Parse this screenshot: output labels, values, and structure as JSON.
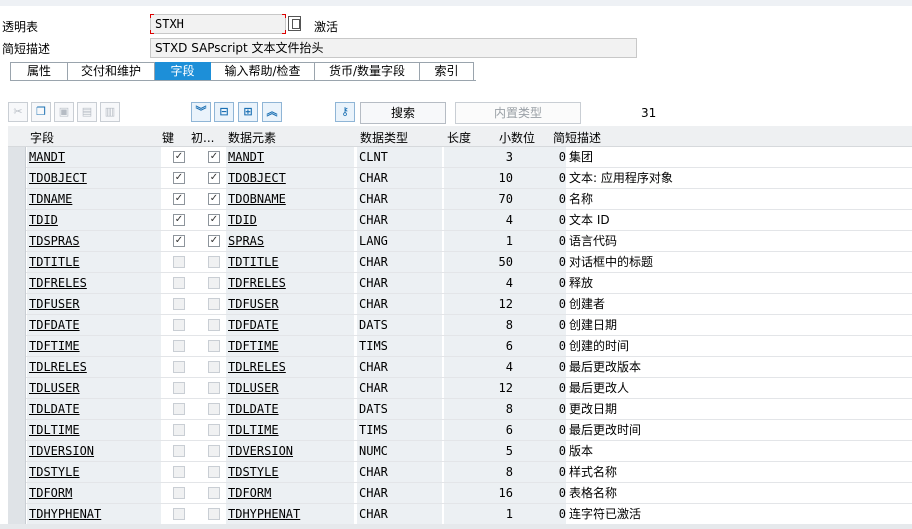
{
  "header": {
    "table_label": "透明表",
    "table_value": "STXH",
    "status": "激活",
    "desc_label": "简短描述",
    "desc_value": "STXD SAPscript 文本文件抬头"
  },
  "tabs": [
    {
      "label": "属性"
    },
    {
      "label": "交付和维护"
    },
    {
      "label": "字段"
    },
    {
      "label": "输入帮助/检查"
    },
    {
      "label": "货币/数量字段"
    },
    {
      "label": "索引"
    }
  ],
  "toolbar": {
    "search_label": "搜索",
    "builtin_label": "内置类型",
    "count": "31"
  },
  "grid": {
    "columns": [
      "字段",
      "键",
      "初...",
      "数据元素",
      "数据类型",
      "长度",
      "小数位",
      "简短描述"
    ],
    "rows": [
      {
        "field": "MANDT",
        "key": true,
        "init": true,
        "elem": "MANDT",
        "type": "CLNT",
        "len": "3",
        "dec": "0",
        "desc": "集团"
      },
      {
        "field": "TDOBJECT",
        "key": true,
        "init": true,
        "elem": "TDOBJECT",
        "type": "CHAR",
        "len": "10",
        "dec": "0",
        "desc": "文本: 应用程序对象"
      },
      {
        "field": "TDNAME",
        "key": true,
        "init": true,
        "elem": "TDOBNAME",
        "type": "CHAR",
        "len": "70",
        "dec": "0",
        "desc": "名称"
      },
      {
        "field": "TDID",
        "key": true,
        "init": true,
        "elem": "TDID",
        "type": "CHAR",
        "len": "4",
        "dec": "0",
        "desc": "文本 ID"
      },
      {
        "field": "TDSPRAS",
        "key": true,
        "init": true,
        "elem": "SPRAS",
        "type": "LANG",
        "len": "1",
        "dec": "0",
        "desc": "语言代码"
      },
      {
        "field": "TDTITLE",
        "key": false,
        "init": false,
        "elem": "TDTITLE",
        "type": "CHAR",
        "len": "50",
        "dec": "0",
        "desc": "对话框中的标题"
      },
      {
        "field": "TDFRELES",
        "key": false,
        "init": false,
        "elem": "TDFRELES",
        "type": "CHAR",
        "len": "4",
        "dec": "0",
        "desc": "释放"
      },
      {
        "field": "TDFUSER",
        "key": false,
        "init": false,
        "elem": "TDFUSER",
        "type": "CHAR",
        "len": "12",
        "dec": "0",
        "desc": "创建者"
      },
      {
        "field": "TDFDATE",
        "key": false,
        "init": false,
        "elem": "TDFDATE",
        "type": "DATS",
        "len": "8",
        "dec": "0",
        "desc": "创建日期"
      },
      {
        "field": "TDFTIME",
        "key": false,
        "init": false,
        "elem": "TDFTIME",
        "type": "TIMS",
        "len": "6",
        "dec": "0",
        "desc": "创建的时间"
      },
      {
        "field": "TDLRELES",
        "key": false,
        "init": false,
        "elem": "TDLRELES",
        "type": "CHAR",
        "len": "4",
        "dec": "0",
        "desc": "最后更改版本"
      },
      {
        "field": "TDLUSER",
        "key": false,
        "init": false,
        "elem": "TDLUSER",
        "type": "CHAR",
        "len": "12",
        "dec": "0",
        "desc": "最后更改人"
      },
      {
        "field": "TDLDATE",
        "key": false,
        "init": false,
        "elem": "TDLDATE",
        "type": "DATS",
        "len": "8",
        "dec": "0",
        "desc": "更改日期"
      },
      {
        "field": "TDLTIME",
        "key": false,
        "init": false,
        "elem": "TDLTIME",
        "type": "TIMS",
        "len": "6",
        "dec": "0",
        "desc": "最后更改时间"
      },
      {
        "field": "TDVERSION",
        "key": false,
        "init": false,
        "elem": "TDVERSION",
        "type": "NUMC",
        "len": "5",
        "dec": "0",
        "desc": "版本"
      },
      {
        "field": "TDSTYLE",
        "key": false,
        "init": false,
        "elem": "TDSTYLE",
        "type": "CHAR",
        "len": "8",
        "dec": "0",
        "desc": "样式名称"
      },
      {
        "field": "TDFORM",
        "key": false,
        "init": false,
        "elem": "TDFORM",
        "type": "CHAR",
        "len": "16",
        "dec": "0",
        "desc": "表格名称"
      },
      {
        "field": "TDHYPHENAT",
        "key": false,
        "init": false,
        "elem": "TDHYPHENAT",
        "type": "CHAR",
        "len": "1",
        "dec": "0",
        "desc": "连字符已激活"
      }
    ]
  },
  "colors": {
    "accent": "#1d8fd8",
    "header_bg": "#eef0f2",
    "cell_bg": "#ecf0f3"
  }
}
